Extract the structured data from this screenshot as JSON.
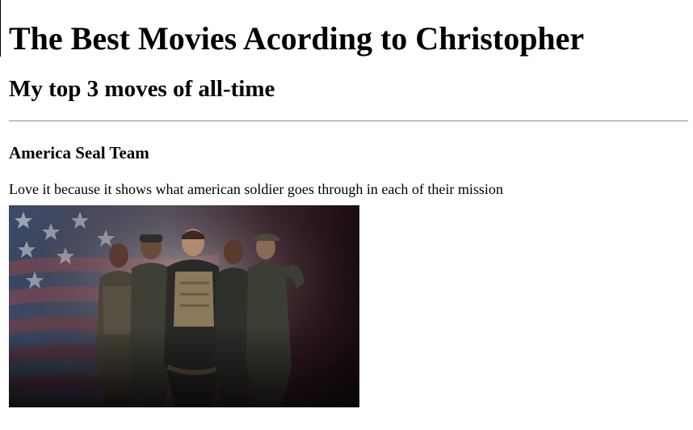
{
  "page": {
    "title": "The Best Movies Acording to Christopher",
    "subtitle": "My top 3 moves of all-time"
  },
  "movies": [
    {
      "title": "America Seal Team",
      "description": "Love it because it shows what american soldier goes through in each of their mission",
      "image_description": "Cast of soldiers in tactical gear posing in front of an American flag"
    }
  ],
  "colors": {
    "text": "#000000",
    "background": "#ffffff",
    "divider": "#9a9a9a"
  }
}
